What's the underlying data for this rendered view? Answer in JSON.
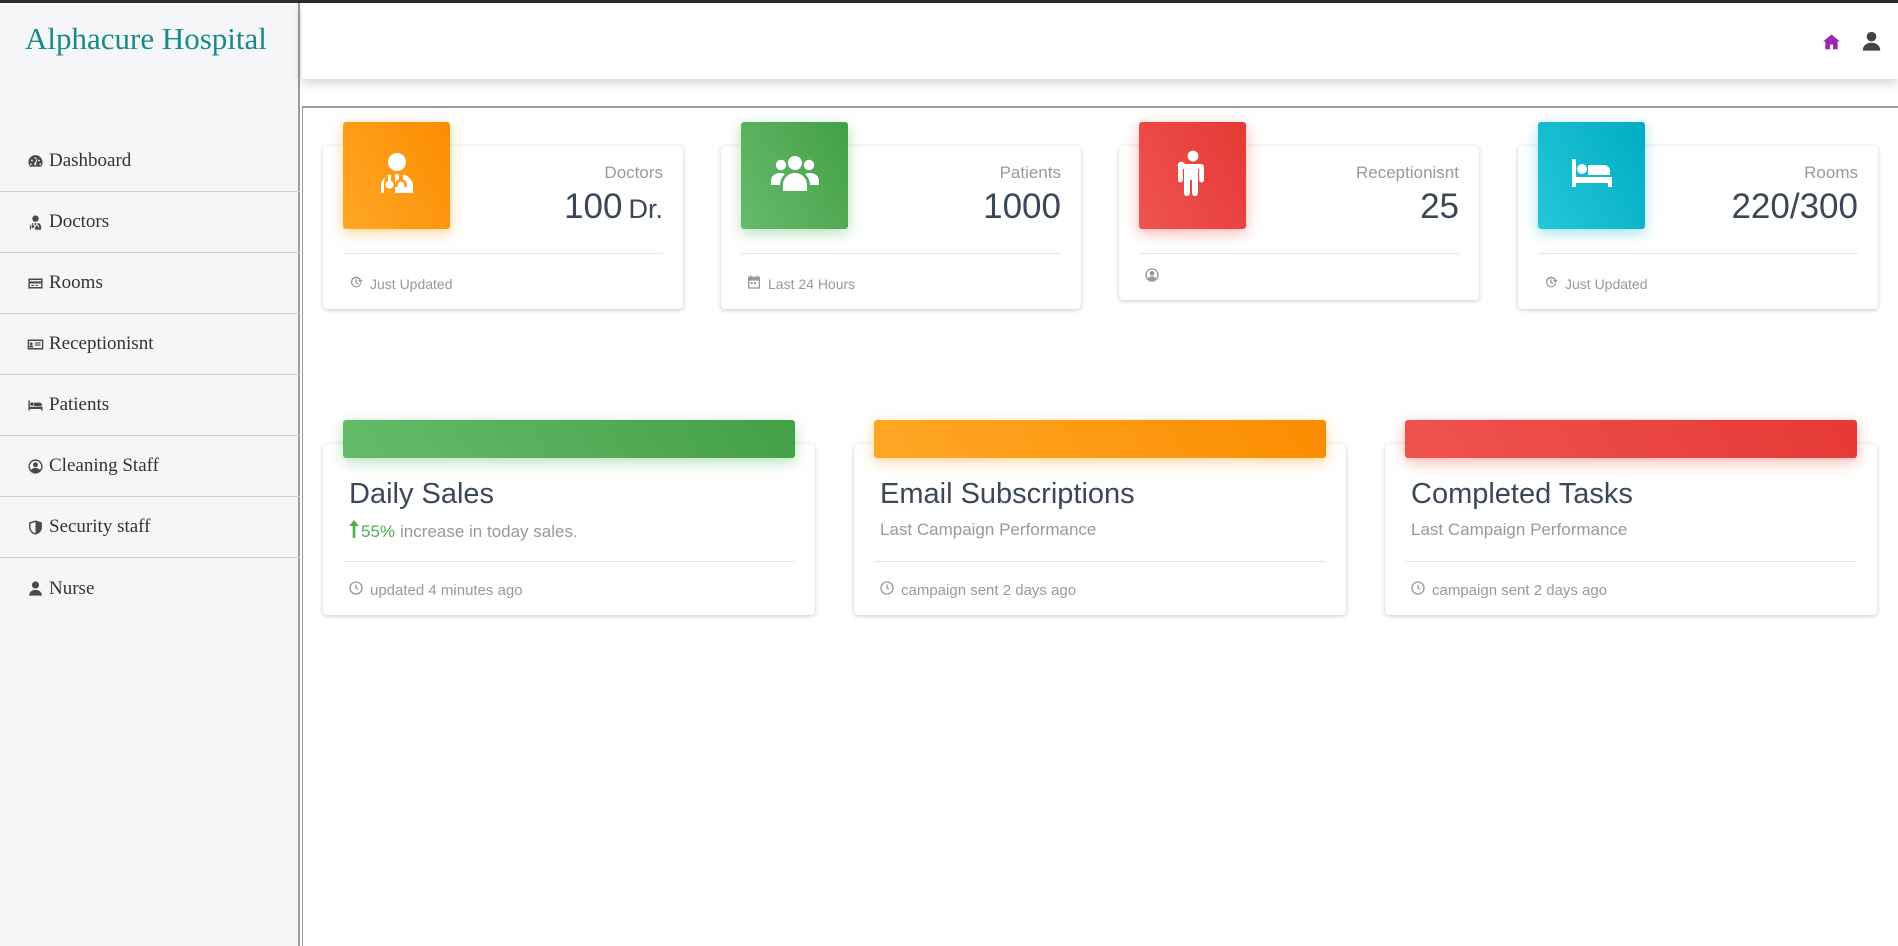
{
  "brand": {
    "title": "Alphacure Hospital",
    "color": "#178a8a"
  },
  "sidebar": {
    "items": [
      {
        "label": "Dashboard",
        "icon": "tachometer-icon"
      },
      {
        "label": "Doctors",
        "icon": "user-md-icon"
      },
      {
        "label": "Rooms",
        "icon": "credit-card-icon"
      },
      {
        "label": "Receptionisnt",
        "icon": "id-card-icon"
      },
      {
        "label": "Patients",
        "icon": "bed-icon"
      },
      {
        "label": "Cleaning Staff",
        "icon": "user-circle-icon"
      },
      {
        "label": "Security staff",
        "icon": "shield-icon"
      },
      {
        "label": "Nurse",
        "icon": "user-icon"
      }
    ]
  },
  "topbar": {
    "icons": [
      "home-icon",
      "user-icon"
    ],
    "home_color": "#9c27b0"
  },
  "stats": [
    {
      "title": "Doctors",
      "value": "100",
      "unit": "Dr.",
      "footer": "Just Updated",
      "icon": "user-md-icon",
      "footer_icon": "refresh-icon",
      "color": "#fb8c00"
    },
    {
      "title": "Patients",
      "value": "1000",
      "unit": "",
      "footer": "Last 24 Hours",
      "icon": "users-icon",
      "footer_icon": "calendar-icon",
      "color": "#43a047"
    },
    {
      "title": "Receptionisnt",
      "value": "25",
      "unit": "",
      "footer": "",
      "icon": "male-icon",
      "footer_icon": "user-circle-icon",
      "color": "#e53935"
    },
    {
      "title": "Rooms",
      "value": "220/300",
      "unit": "",
      "footer": "Just Updated",
      "icon": "bed-icon",
      "footer_icon": "refresh-icon",
      "color": "#00acc1"
    }
  ],
  "charts": [
    {
      "title": "Daily Sales",
      "percent": "55%",
      "subtitle": "increase in today sales.",
      "footer": "updated 4 minutes ago",
      "color": "#43a047"
    },
    {
      "title": "Email Subscriptions",
      "percent": "",
      "subtitle": "Last Campaign Performance",
      "footer": "campaign sent 2 days ago",
      "color": "#fb8c00"
    },
    {
      "title": "Completed Tasks",
      "percent": "",
      "subtitle": "Last Campaign Performance",
      "footer": "campaign sent 2 days ago",
      "color": "#e53935"
    }
  ]
}
